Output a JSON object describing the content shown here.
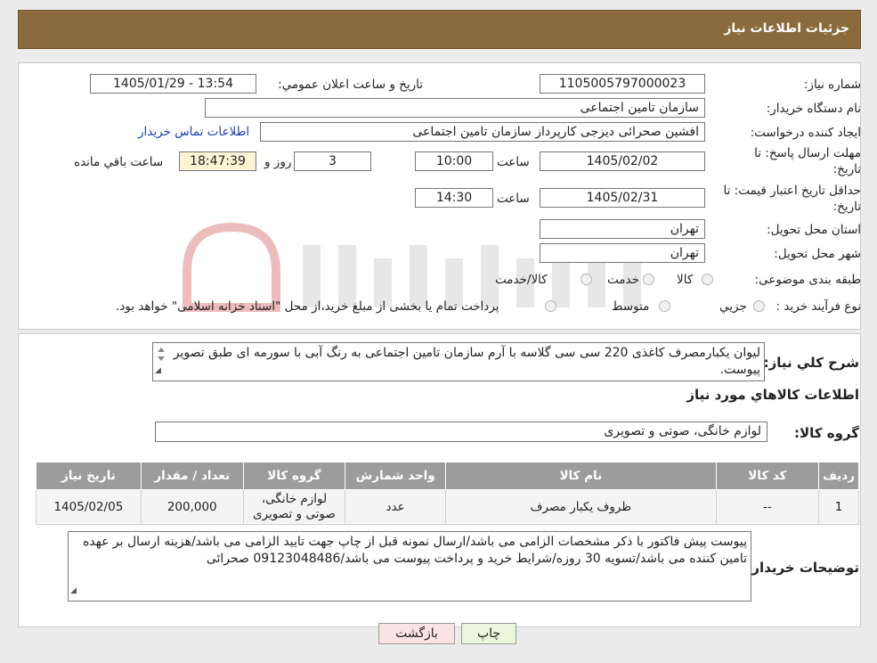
{
  "header": {
    "title": "جزئیات اطلاعات نیاز"
  },
  "form": {
    "need_number_label": "شماره نیاز:",
    "need_number": "1105005797000023",
    "announce_label": "تاريخ و ساعت اعلان عمومي:",
    "announce_value": "1405/01/29 - 13:54",
    "buyer_org_label": "نام دستگاه خريدار:",
    "buyer_org": "سازمان تامین اجتماعی",
    "creator_label": "ايجاد کننده درخواست:",
    "creator": "افشین صحرائی دیزجی کارپرداز سازمان تامین اجتماعی",
    "contact_link": "اطلاعات تماس خريدار",
    "reply_deadline_label_1": "مهلت ارسال پاسخ: تا",
    "reply_deadline_label_2": "تاريخ:",
    "reply_date": "1405/02/02",
    "time_label": "ساعت",
    "reply_time": "10:00",
    "days_value": "3",
    "days_label": "روز و",
    "remaining_time": "18:47:39",
    "remaining_label": "ساعت باقي مانده",
    "validity_label_1": "حداقل تاريخ اعتبار قيمت: تا",
    "validity_label_2": "تاريخ:",
    "validity_date": "1405/02/31",
    "validity_time": "14:30",
    "province_label": "استان محل تحويل:",
    "province": "تهران",
    "city_label": "شهر محل تحويل:",
    "city": "تهران",
    "category_label": "طبقه بندی موضوعی:",
    "category_options": [
      "کالا",
      "خدمت",
      "کالا/خدمت"
    ],
    "process_label": "نوع فرآيند خريد :",
    "process_options": [
      "جزيي",
      "متوسط"
    ],
    "process_note": "پرداخت تمام يا بخشی از مبلغ خريد،از محل \"اسناد خزانه اسلامی\" خواهد بود."
  },
  "details": {
    "description_label": "شرح کلي نياز:",
    "description": "لیوان یکبارمصرف کاغذی 220 سی سی گلاسه با آرم سازمان تامین اجتماعی به رنگ آبی با سورمه ای طبق تصویر پیوست.",
    "goods_info_title": "اطلاعات کالاهاي مورد نياز",
    "goods_group_label": "گروه کالا:",
    "goods_group": "لوازم خانگی، صوتی و تصویری",
    "table": {
      "headers": [
        "رديف",
        "کد کالا",
        "نام کالا",
        "واحد شمارش",
        "گروه کالا",
        "تعداد / مقدار",
        "تاريخ نياز"
      ],
      "rows": [
        [
          "1",
          "--",
          "ظروف یکبار مصرف",
          "عدد",
          "لوازم خانگی، صوتی و تصویری",
          "200,000",
          "1405/02/05"
        ]
      ]
    },
    "buyer_notes_label": "توضيحات خريدار:",
    "buyer_notes": "پیوست پیش فاکتور با ذکر مشخصات الزامی می باشد/ارسال نمونه قبل از چاپ جهت تایید الزامی می باشد/هزینه ارسال بر عهده تامین کننده می باشد/تسویه 30 روزه/شرایط خرید و پرداخت پیوست می باشد/09123048486 صحرائی"
  },
  "buttons": {
    "print": "چاپ",
    "back": "بازگشت"
  },
  "colors": {
    "header_bg": "#8b6b3d",
    "table_header_bg": "#9c9c9c",
    "link": "#1a3fb5",
    "timer_bg": "#fcf4d3"
  }
}
